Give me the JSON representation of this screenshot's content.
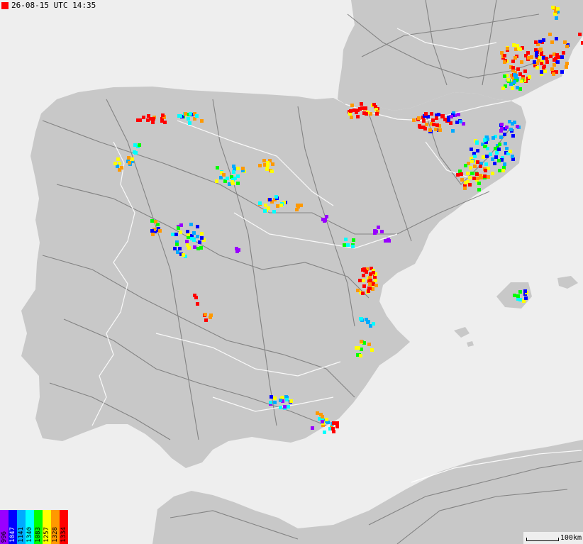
{
  "timestamp": "26-08-15 UTC 14:35",
  "legend": [
    {
      "label": "996",
      "color": "#9900ff"
    },
    {
      "label": "1047",
      "color": "#0000ff"
    },
    {
      "label": "1141",
      "color": "#00aaff"
    },
    {
      "label": "1340",
      "color": "#00ffff"
    },
    {
      "label": "1083",
      "color": "#00ff00"
    },
    {
      "label": "1257",
      "color": "#ffff00"
    },
    {
      "label": "1328",
      "color": "#ff9900"
    },
    {
      "label": "1334",
      "color": "#ff0000"
    }
  ],
  "scale": {
    "label": "100km"
  },
  "colors": {
    "land": "#c8c8c8",
    "sea": "#eeeeee",
    "roads": "#777777",
    "borders": "#ffffff"
  }
}
